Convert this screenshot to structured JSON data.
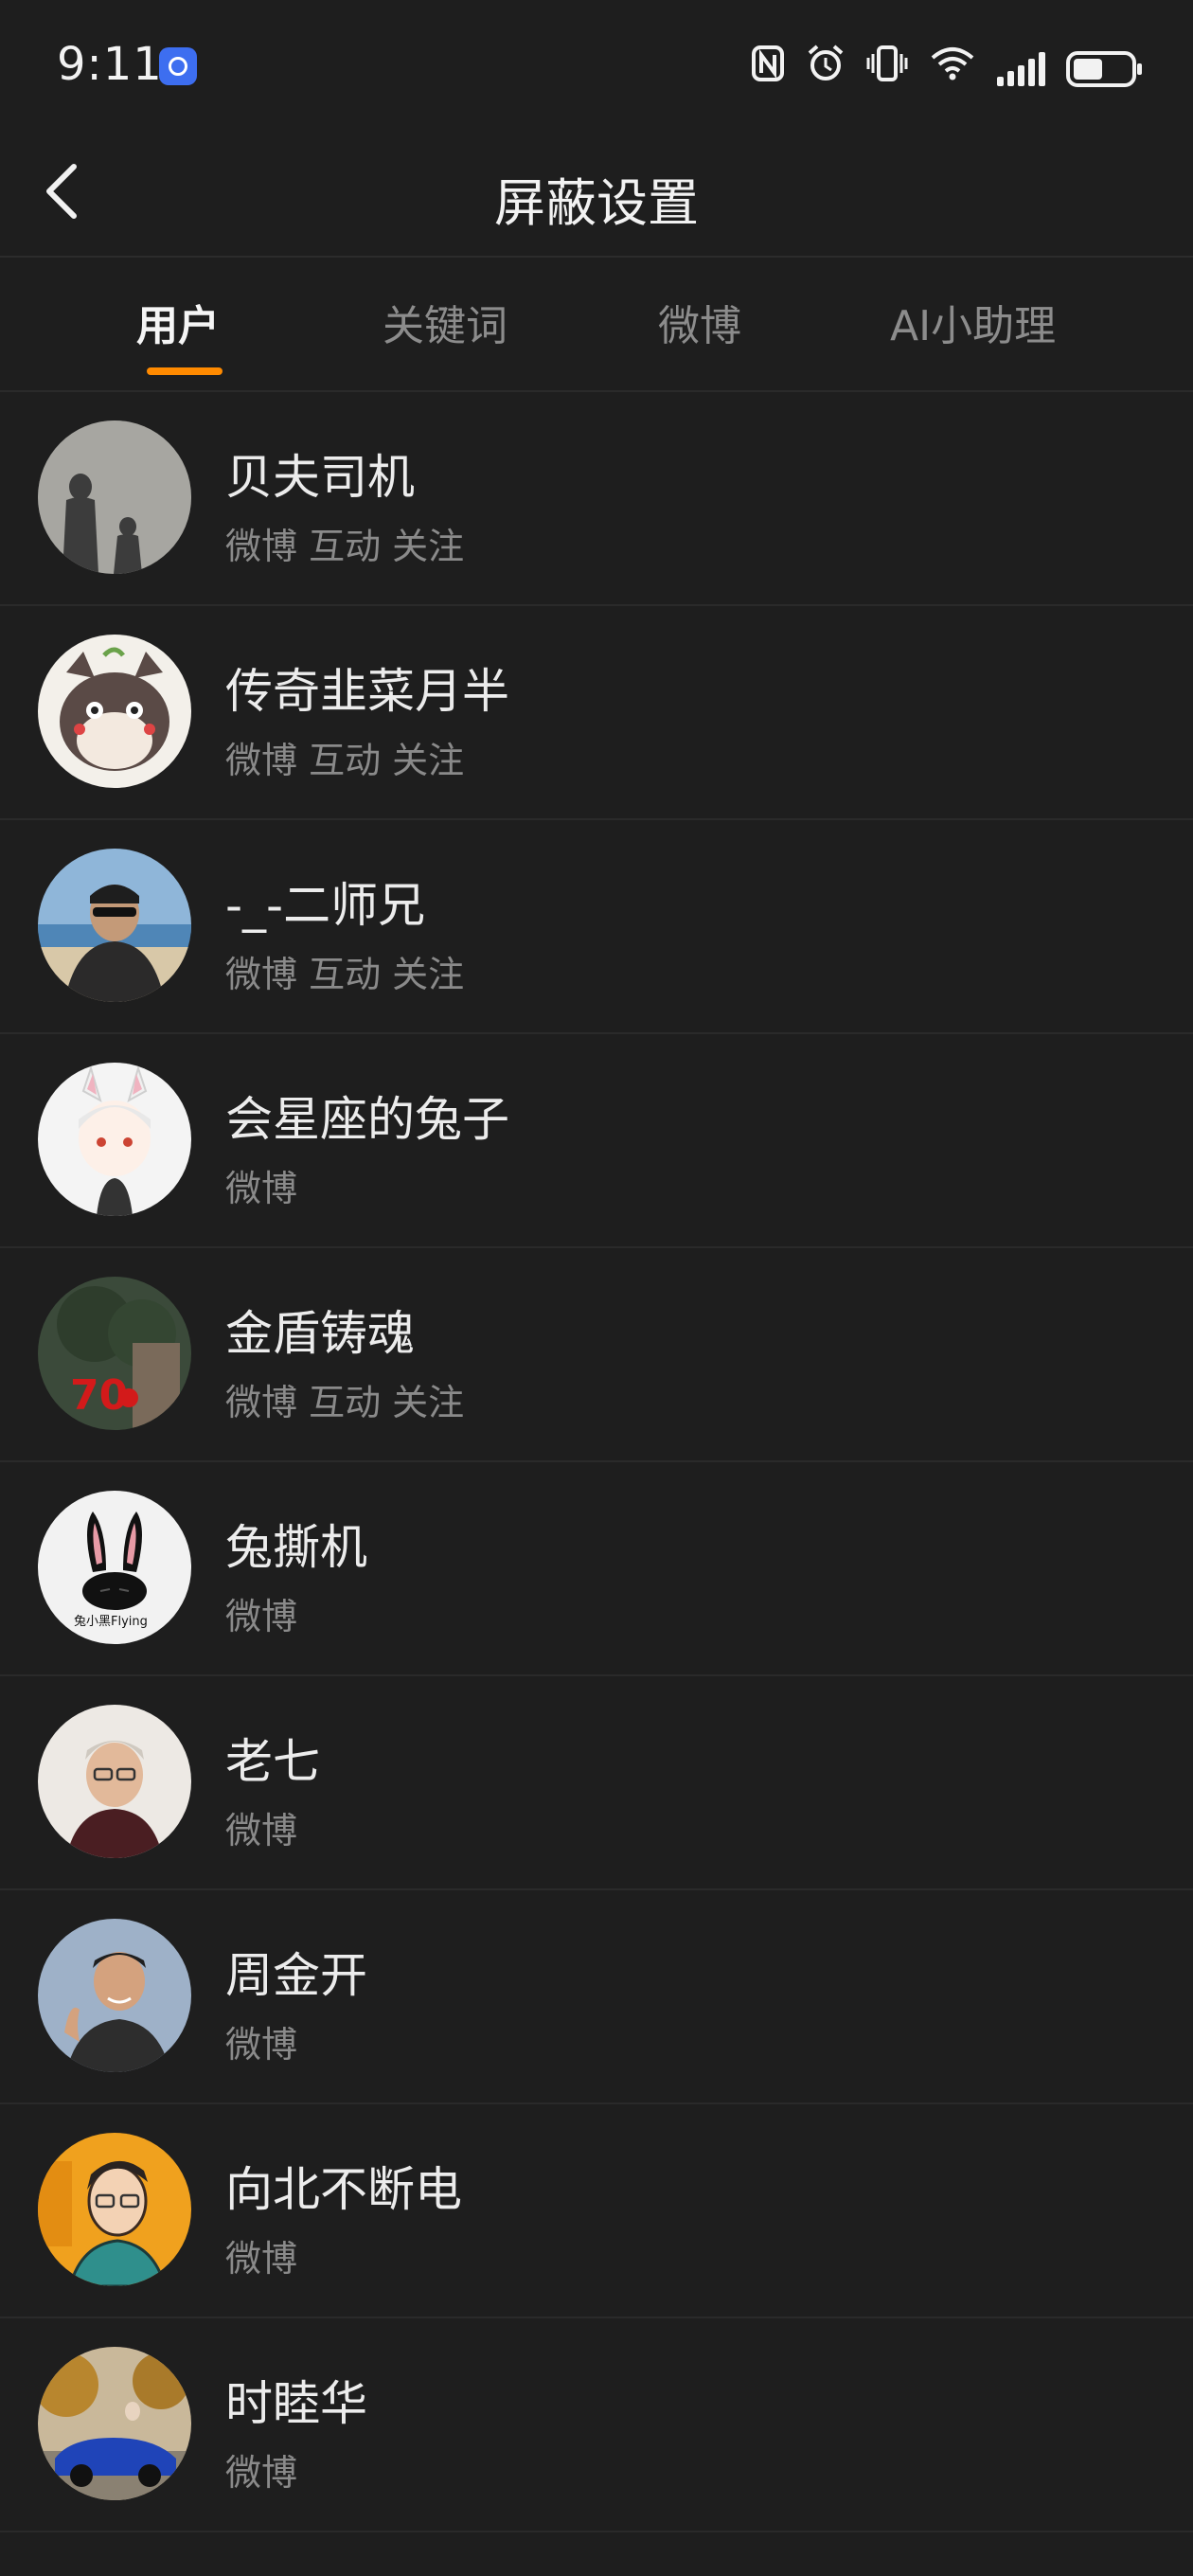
{
  "status_bar": {
    "time": "9:11",
    "icons": [
      "nfc-icon",
      "alarm-icon",
      "vibrate-icon",
      "wifi-icon",
      "signal-icon",
      "battery-icon"
    ]
  },
  "header": {
    "title": "屏蔽设置"
  },
  "tabs": [
    {
      "label": "用户",
      "active": true
    },
    {
      "label": "关键词",
      "active": false
    },
    {
      "label": "微博",
      "active": false
    },
    {
      "label": "AI小助理",
      "active": false
    }
  ],
  "colors": {
    "background": "#1e1e1e",
    "accent": "#ff8a00",
    "primary_text": "#ececec",
    "secondary_text": "#8a8a8a"
  },
  "blocked_users": [
    {
      "name": "贝夫司机",
      "scope": "微博 互动 关注"
    },
    {
      "name": "传奇韭菜月半",
      "scope": "微博 互动 关注"
    },
    {
      "name": "-_-二师兄",
      "scope": "微博 互动 关注"
    },
    {
      "name": "会星座的兔子",
      "scope": "微博"
    },
    {
      "name": "金盾铸魂",
      "scope": "微博 互动 关注"
    },
    {
      "name": "兔撕机",
      "scope": "微博"
    },
    {
      "name": "老七",
      "scope": "微博"
    },
    {
      "name": "周金开",
      "scope": "微博"
    },
    {
      "name": "向北不断电",
      "scope": "微博"
    },
    {
      "name": "时睦华",
      "scope": "微博"
    }
  ]
}
